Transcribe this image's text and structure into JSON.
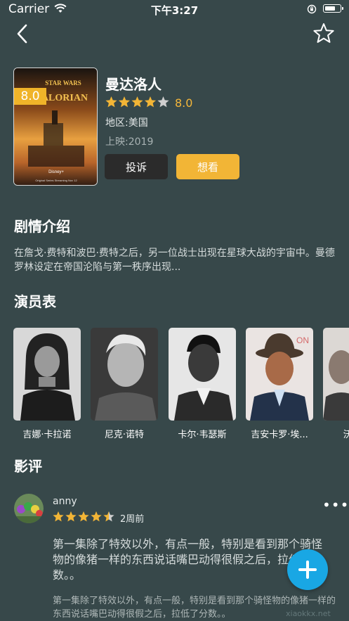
{
  "status_bar": {
    "carrier": "Carrier",
    "time": "下午3:27"
  },
  "movie": {
    "title": "曼达洛人",
    "rating": 8.0,
    "rating_text": "8.0",
    "poster_score": "8.0",
    "region": "地区:美国",
    "release": "上映:2019",
    "stars_filled": 4,
    "stars_total": 5
  },
  "actions": {
    "report_label": "投诉",
    "want_label": "想看"
  },
  "synopsis": {
    "title": "剧情介绍",
    "text": "在詹戈·费特和波巴·费特之后，另一位战士出现在星球大战的宇宙中。曼德罗林设定在帝国沦陷与第一秩序出现..."
  },
  "cast": {
    "title": "演员表",
    "members": [
      {
        "name": "吉娜·卡拉诺"
      },
      {
        "name": "尼克·诺特"
      },
      {
        "name": "卡尔·韦瑟斯"
      },
      {
        "name": "吉安卡罗·埃..."
      },
      {
        "name": "沃纳..."
      }
    ]
  },
  "reviews": {
    "title": "影评",
    "items": [
      {
        "username": "anny",
        "rating_stars": 4.5,
        "time": "2周前",
        "content": "第一集除了特效以外，有点一般，特别是看到那个骑怪物的像猪一样的东西说话嘴巴动得很假之后，拉低了分数。。",
        "content_secondary": "第一集除了特效以外，有点一般，特别是看到那个骑怪物的像猪一样的东西说话嘴巴动得很假之后，拉低了分数。。"
      }
    ]
  },
  "watermark": "xiaokkx.net",
  "colors": {
    "background": "#37484a",
    "accent": "#f2b536",
    "fab": "#19a7e4"
  }
}
